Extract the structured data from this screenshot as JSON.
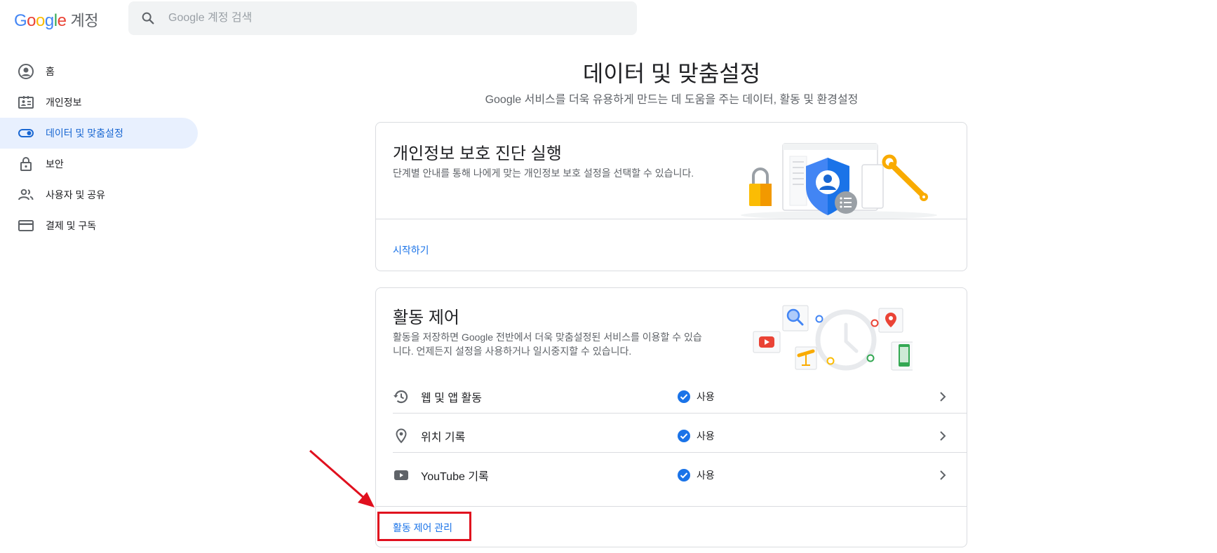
{
  "header": {
    "logo_letters": [
      "G",
      "o",
      "o",
      "g",
      "l",
      "e"
    ],
    "product": "계정",
    "search_placeholder": "Google 계정 검색"
  },
  "sidebar": {
    "items": [
      {
        "label": "홈",
        "icon": "account-circle-icon"
      },
      {
        "label": "개인정보",
        "icon": "id-card-icon"
      },
      {
        "label": "데이터 및 맞춤설정",
        "icon": "toggle-icon",
        "active": true
      },
      {
        "label": "보안",
        "icon": "lock-icon"
      },
      {
        "label": "사용자 및 공유",
        "icon": "people-icon"
      },
      {
        "label": "결제 및 구독",
        "icon": "credit-card-icon"
      }
    ]
  },
  "main": {
    "title": "데이터 및 맞춤설정",
    "subtitle": "Google 서비스를 더욱 유용하게 만드는 데 도움을 주는 데이터, 활동 및 환경설정"
  },
  "privacy_card": {
    "title": "개인정보 보호 진단 실행",
    "description": "단계별 안내를 통해 나에게 맞는 개인정보 보호 설정을 선택할 수 있습니다.",
    "link": "시작하기"
  },
  "activity_card": {
    "title": "활동 제어",
    "description": "활동을 저장하면 Google 전반에서 더욱 맞춤설정된 서비스를 이용할 수 있습니다. 언제든지 설정을 사용하거나 일시중지할 수 있습니다.",
    "rows": [
      {
        "label": "웹 및 앱 활동",
        "status": "사용",
        "icon": "history-icon"
      },
      {
        "label": "위치 기록",
        "status": "사용",
        "icon": "location-pin-icon"
      },
      {
        "label": "YouTube 기록",
        "status": "사용",
        "icon": "youtube-icon"
      }
    ],
    "link": "활동 제어 관리"
  },
  "colors": {
    "accent": "#1a73e8",
    "active_bg": "#e8f0fe",
    "annotation_red": "#e0101e"
  }
}
